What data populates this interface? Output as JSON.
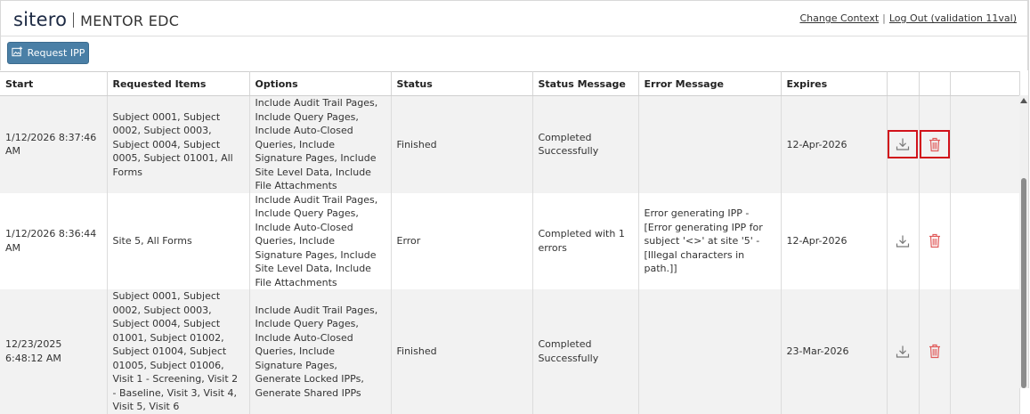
{
  "brand": {
    "sitero": "sitero",
    "product": "MENTOR EDC",
    "colors": {
      "navy": "#1d2a44",
      "accent_button": "#4a7fa6",
      "delete_icon": "#e05a5a",
      "highlight": "#d1121b"
    }
  },
  "top_links": {
    "change_context": "Change Context",
    "separator": "|",
    "logout": "Log Out (validation 11val)"
  },
  "toolbar": {
    "request_ipp_label": "Request IPP",
    "request_ipp_icon": "image-add-icon"
  },
  "table": {
    "columns": [
      "Start",
      "Requested Items",
      "Options",
      "Status",
      "Status Message",
      "Error Message",
      "Expires",
      "",
      "",
      ""
    ],
    "rows": [
      {
        "start": "1/12/2026 8:37:46 AM",
        "requested_items": "Subject 0001, Subject 0002, Subject 0003, Subject 0004, Subject 0005, Subject 01001, All Forms",
        "options": "Include Audit Trail Pages, Include Query Pages, Include Auto-Closed Queries, Include Signature Pages, Include Site Level Data, Include File Attachments",
        "status": "Finished",
        "status_message": "Completed Successfully",
        "error_message": "",
        "expires": "12-Apr-2026",
        "download_icon": "download-icon",
        "delete_icon": "trash-icon",
        "highlighted": true
      },
      {
        "start": "1/12/2026 8:36:44 AM",
        "requested_items": "Site 5, All Forms",
        "options": "Include Audit Trail Pages, Include Query Pages, Include Auto-Closed Queries, Include Signature Pages, Include Site Level Data, Include File Attachments",
        "status": "Error",
        "status_message": "Completed with 1 errors",
        "error_message": "Error generating IPP - [Error generating IPP for subject '<>' at site '5' - [Illegal characters in path.]]",
        "expires": "12-Apr-2026",
        "download_icon": "download-icon",
        "delete_icon": "trash-icon",
        "highlighted": false
      },
      {
        "start": "12/23/2025 6:48:12 AM",
        "requested_items": "Subject 0001, Subject 0002, Subject 0003, Subject 0004, Subject 01001, Subject 01002, Subject 01004, Subject 01005, Subject 01006, Visit 1 - Screening, Visit 2 - Baseline, Visit 3, Visit 4, Visit 5, Visit 6",
        "options": "Include Audit Trail Pages, Include Query Pages, Include Auto-Closed Queries, Include Signature Pages, Generate Locked IPPs, Generate Shared IPPs",
        "status": "Finished",
        "status_message": "Completed Successfully",
        "error_message": "",
        "expires": "23-Mar-2026",
        "download_icon": "download-icon",
        "delete_icon": "trash-icon",
        "highlighted": false
      }
    ]
  }
}
